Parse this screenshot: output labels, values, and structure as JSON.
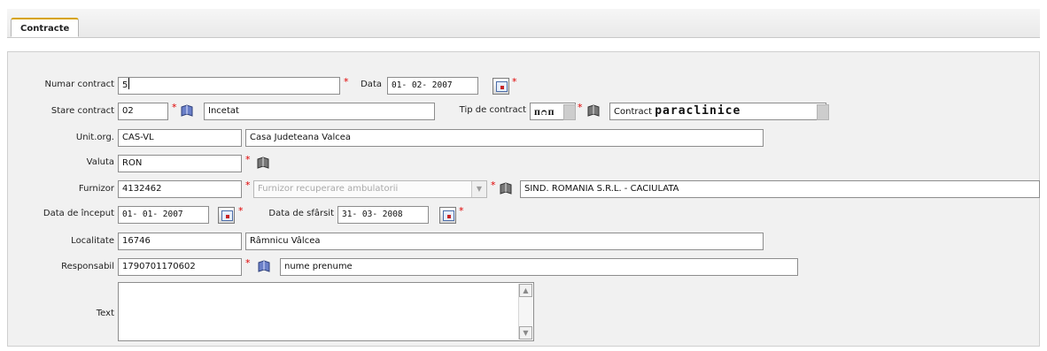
{
  "tabs": [
    {
      "label": "Contracte",
      "active": true
    }
  ],
  "form": {
    "numar_contract": {
      "label": "Numar contract",
      "value": "5"
    },
    "data": {
      "label": "Data",
      "value": "01- 02- 2007"
    },
    "stare_contract": {
      "label": "Stare contract",
      "code": "02",
      "name": "Incetat"
    },
    "tip_contract": {
      "label": "Tip de contract",
      "code": "ᴨᴒᴨ",
      "name_prefix": "Contract",
      "name_suffix": "paraclinice"
    },
    "unit_org": {
      "label": "Unit.org.",
      "code": "CAS-VL",
      "name": "Casa Judeteana Valcea"
    },
    "valuta": {
      "label": "Valuta",
      "value": "RON"
    },
    "furnizor": {
      "label": "Furnizor",
      "code": "4132462",
      "type_placeholder": "Furnizor recuperare ambulatorii",
      "name": "SIND. ROMANIA S.R.L. - CACIULATA"
    },
    "data_inceput": {
      "label": "Data de început",
      "value": "01- 01- 2007"
    },
    "data_sfarsit": {
      "label": "Data de sfârsit",
      "value": "31- 03- 2008"
    },
    "localitate": {
      "label": "Localitate",
      "code": "16746",
      "name": "Râmnicu Vâlcea"
    },
    "responsabil": {
      "label": "Responsabil",
      "code": "1790701170602",
      "name": "nume prenume"
    },
    "text": {
      "label": "Text",
      "value": ""
    }
  },
  "colors": {
    "required": "#e00000",
    "tab_accent": "#d7a300",
    "panel_bg": "#f1f1f1"
  },
  "icons": {
    "lookup": "book-lookup-icon",
    "calendar": "calendar-icon"
  }
}
